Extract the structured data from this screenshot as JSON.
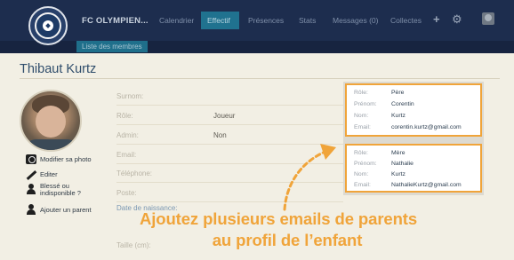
{
  "nav": {
    "team_name": "FC OLYMPIEN...",
    "items": [
      "Calendrier",
      "Effectif",
      "Présences",
      "Stats",
      "Messages (0)",
      "Collectes"
    ],
    "active_index": 1,
    "sub_link": "Liste des membres",
    "icons": [
      "plus-icon",
      "gear-icon",
      "avatar-icon"
    ],
    "accent_color": "#20728f",
    "bar_color": "#1d2d4e"
  },
  "profile": {
    "name": "Thibaut Kurtz",
    "actions": [
      "Modifier sa photo",
      "Editer",
      "Blessé ou",
      "indisponible ?",
      "Ajouter un parent"
    ]
  },
  "fields": [
    {
      "label": "Surnom:",
      "value": ""
    },
    {
      "label": "Rôle:",
      "value": "Joueur"
    },
    {
      "label": "Admin:",
      "value": "Non"
    },
    {
      "label": "Email:",
      "value": ""
    },
    {
      "label": "Téléphone:",
      "value": ""
    },
    {
      "label": "Poste:",
      "value": ""
    },
    {
      "label": "Date de naissance:",
      "value": ""
    },
    {
      "label": "Taille (cm):",
      "value": ""
    }
  ],
  "parents": [
    {
      "role_label": "Rôle:",
      "role": "Père",
      "first_label": "Prénom:",
      "first": "Corentin",
      "last_label": "Nom:",
      "last": "Kurtz",
      "email_label": "Email:",
      "email": "corentin.kurtz@gmail.com"
    },
    {
      "role_label": "Rôle:",
      "role": "Mère",
      "first_label": "Prénom:",
      "first": "Nathalie",
      "last_label": "Nom:",
      "last": "Kurtz",
      "email_label": "Email:",
      "email": "NathalieKurtz@gmail.com"
    }
  ],
  "caption": {
    "line1": "Ajoutez plusieurs emails de parents",
    "line2": "au profil de l’enfant",
    "color": "#f0a43a"
  }
}
